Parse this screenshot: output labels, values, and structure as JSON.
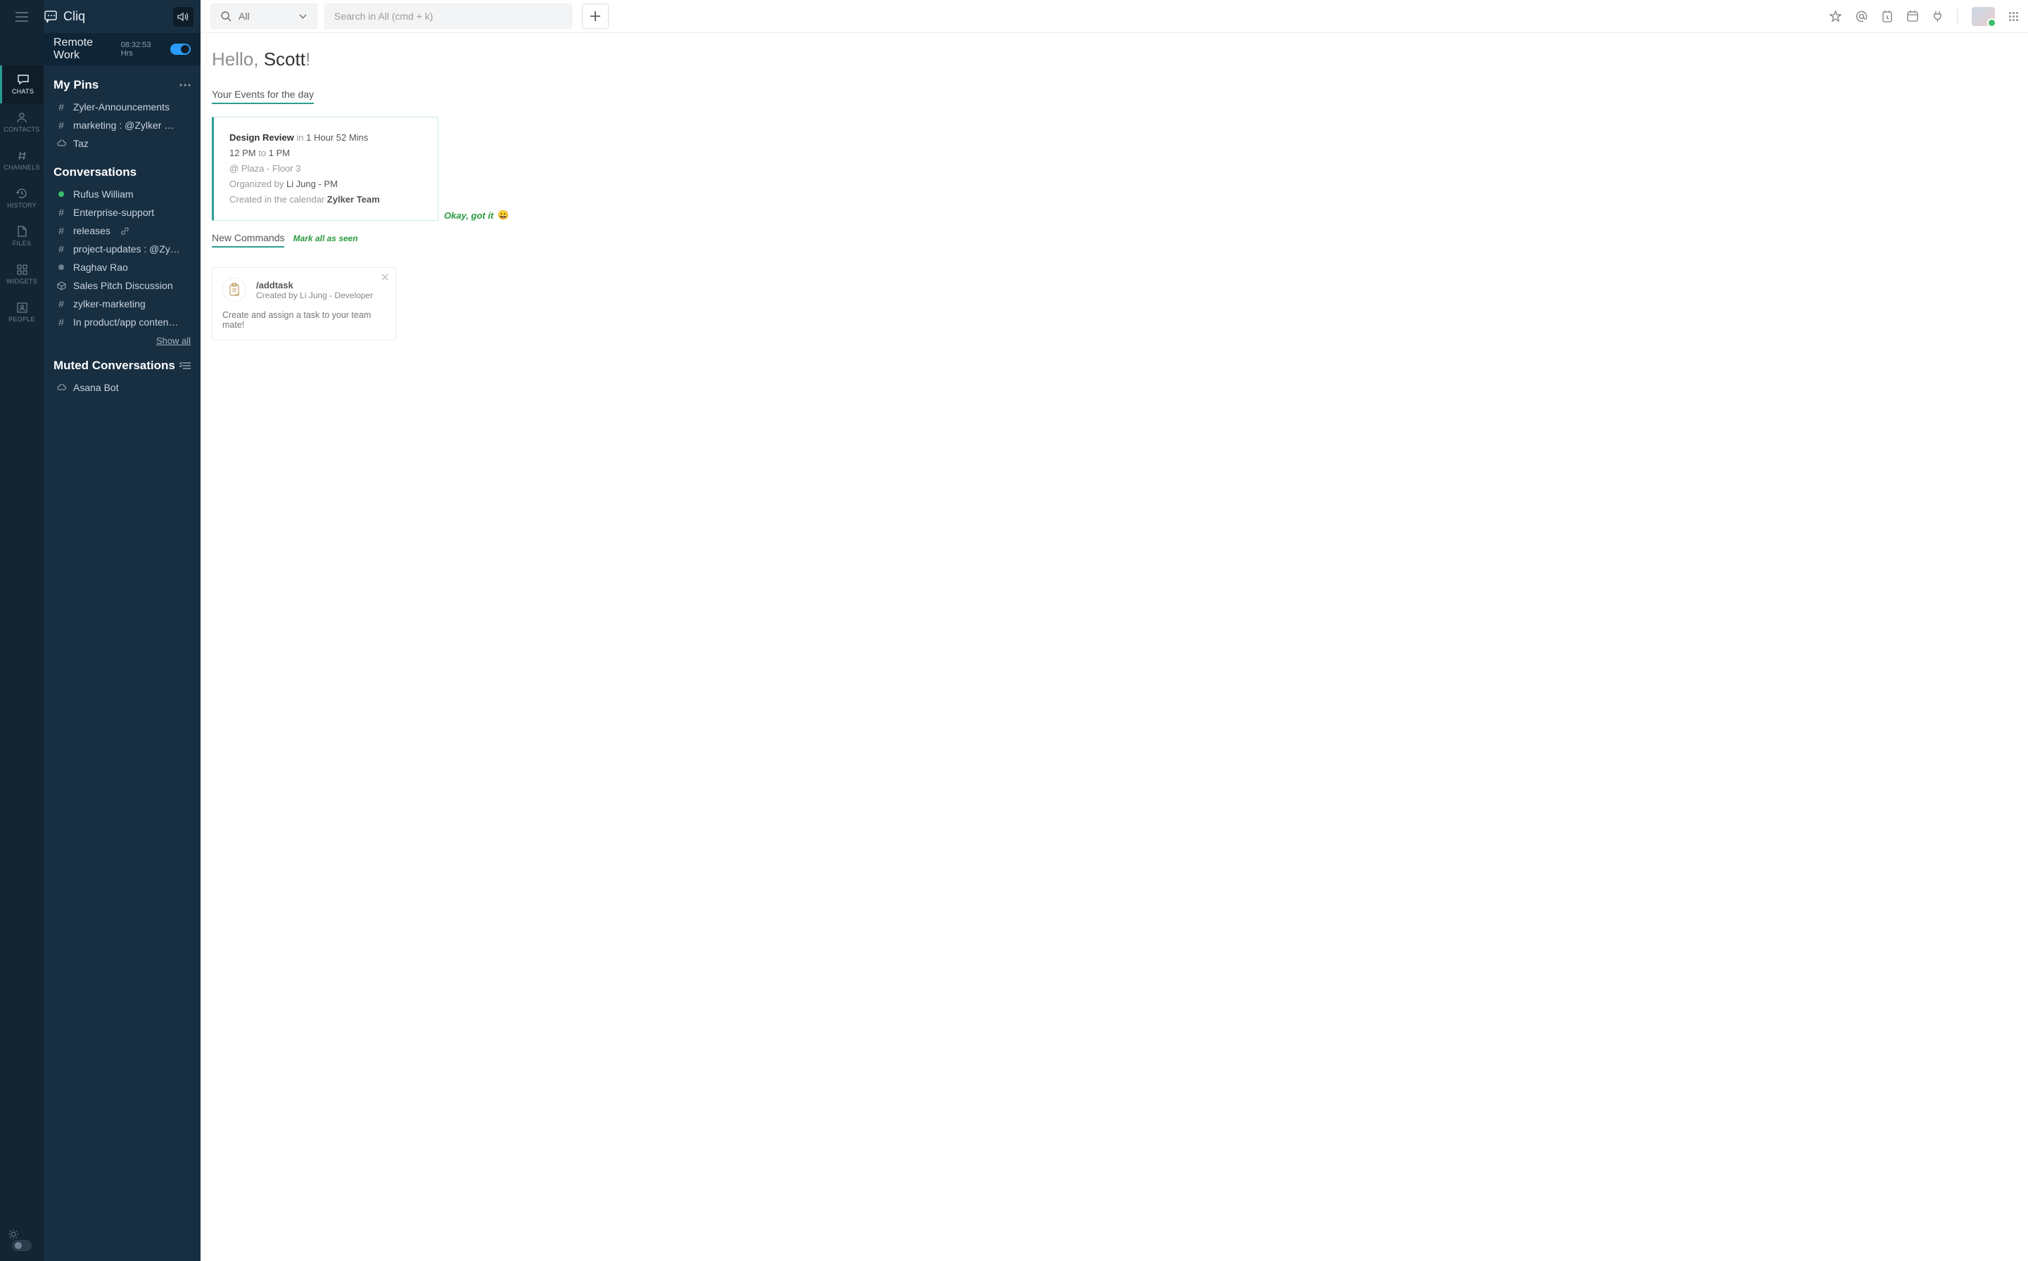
{
  "brand": {
    "name": "Cliq"
  },
  "remote_work": {
    "title": "Remote Work",
    "time": "08:32:53 Hrs",
    "toggle_on": true
  },
  "rail": {
    "items": [
      {
        "label": "CHATS",
        "active": true
      },
      {
        "label": "CONTACTS",
        "active": false
      },
      {
        "label": "CHANNELS",
        "active": false
      },
      {
        "label": "HISTORY",
        "active": false
      },
      {
        "label": "FILES",
        "active": false
      },
      {
        "label": "WIDGETS",
        "active": false
      },
      {
        "label": "PEOPLE",
        "active": false
      }
    ]
  },
  "sections": {
    "pins": {
      "title": "My Pins",
      "items": [
        {
          "icon": "hash",
          "label": "Zyler-Announcements"
        },
        {
          "icon": "hash",
          "label": "marketing : @Zylker …"
        },
        {
          "icon": "cloud",
          "label": "Taz"
        }
      ]
    },
    "conversations": {
      "title": "Conversations",
      "items": [
        {
          "icon": "presence-green",
          "label": "Rufus William"
        },
        {
          "icon": "hash",
          "label": "Enterprise-support"
        },
        {
          "icon": "hash",
          "label": "releases",
          "after_icon": "link"
        },
        {
          "icon": "hash",
          "label": "project-updates : @Zy…"
        },
        {
          "icon": "presence-grey",
          "label": "Raghav Rao"
        },
        {
          "icon": "package",
          "label": "Sales Pitch Discussion"
        },
        {
          "icon": "hash",
          "label": "zylker-marketing"
        },
        {
          "icon": "hash",
          "label": "In product/app conten…"
        }
      ],
      "show_all": "Show all"
    },
    "muted": {
      "title": "Muted Conversations",
      "items": [
        {
          "icon": "cloud",
          "label": "Asana Bot"
        }
      ]
    }
  },
  "topbar": {
    "filter_label": "All",
    "search_placeholder": "Search in All (cmd + k)"
  },
  "greeting": {
    "prefix": "Hello, ",
    "name": "Scott",
    "suffix": "!"
  },
  "events": {
    "heading": "Your Events for the day",
    "card": {
      "title": "Design Review",
      "in_label": "in",
      "countdown": "1 Hour 52 Mins",
      "start": "12 PM",
      "to_label": "to",
      "end": "1 PM",
      "at": "@",
      "location": "Plaza - Floor 3",
      "organized_label": "Organized by",
      "organizer": "Li Jung - PM",
      "calendar_label": "Created in the calendar",
      "calendar_name": "Zylker Team"
    },
    "ack_label": "Okay, got it",
    "ack_emoji": "😀"
  },
  "commands": {
    "heading": "New Commands",
    "mark_all": "Mark all as seen",
    "items": [
      {
        "slash": "/addtask",
        "by_prefix": "Created by ",
        "by": "Li Jung - Developer",
        "desc": "Create and assign a task to your team mate!"
      }
    ]
  }
}
